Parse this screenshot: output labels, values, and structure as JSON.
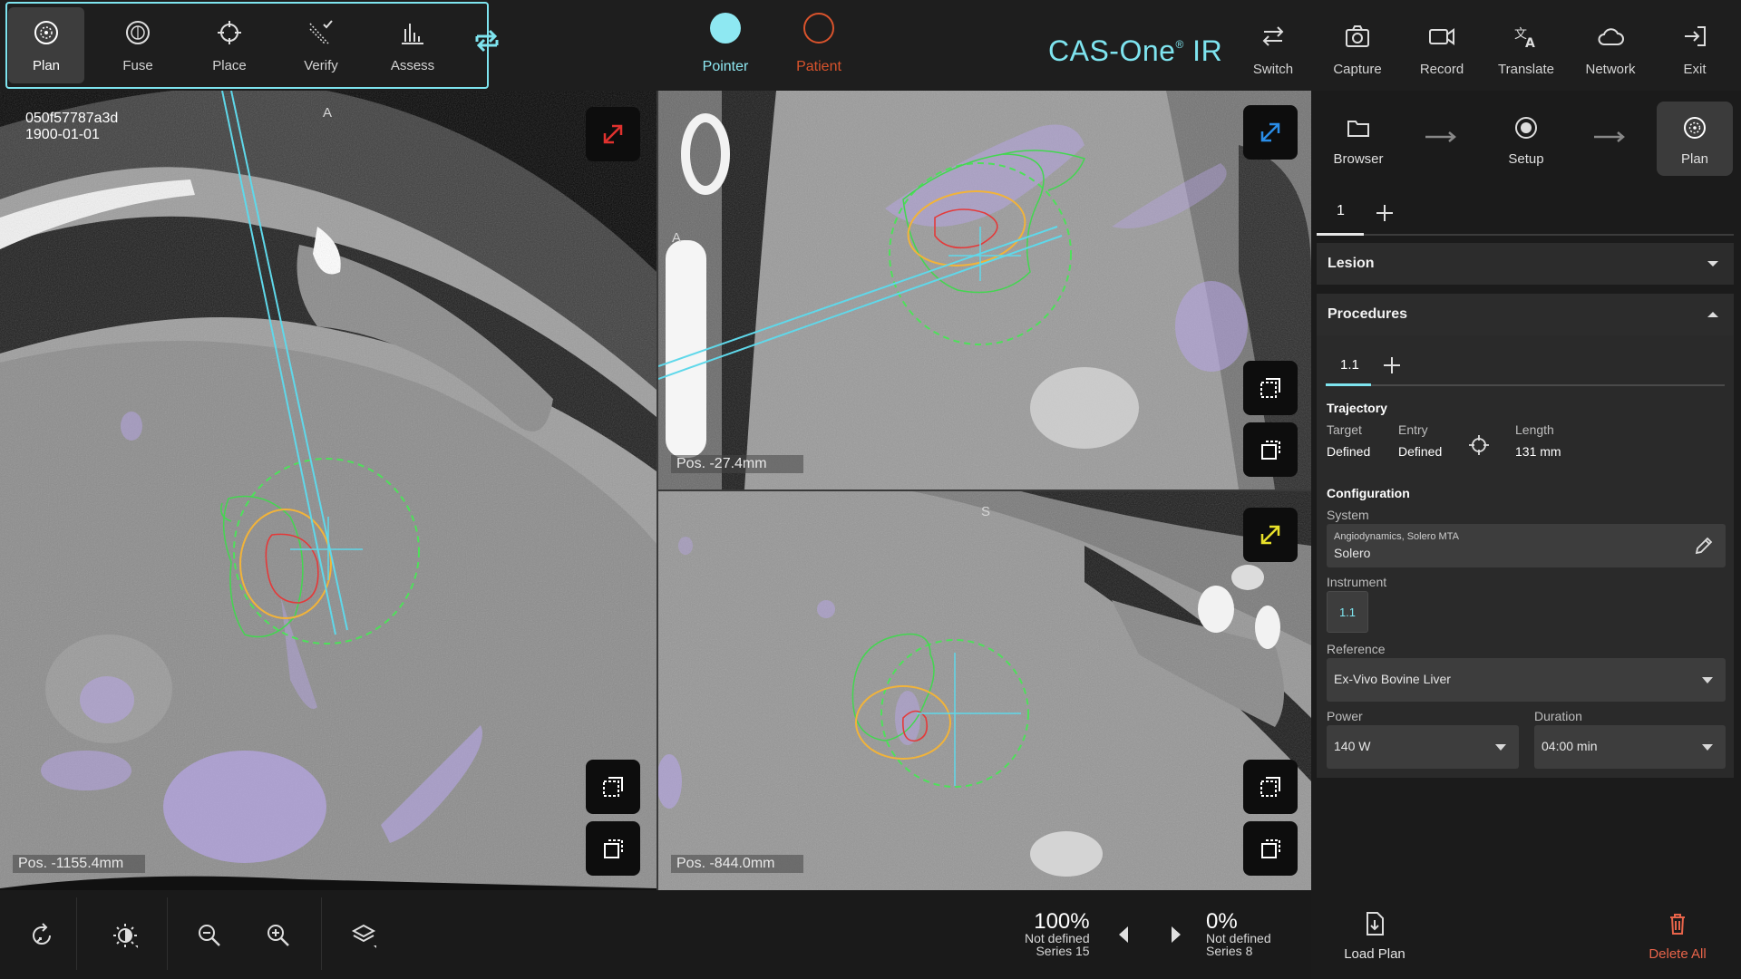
{
  "toolbar": {
    "workflow": [
      {
        "label": "Plan",
        "icon": "plan-icon",
        "active": true
      },
      {
        "label": "Fuse",
        "icon": "fuse-icon"
      },
      {
        "label": "Place",
        "icon": "place-icon"
      },
      {
        "label": "Verify",
        "icon": "verify-icon"
      },
      {
        "label": "Assess",
        "icon": "assess-icon"
      }
    ],
    "modes": [
      {
        "label": "Pointer",
        "color": "#8ee8f2"
      },
      {
        "label": "Patient",
        "color": "#d9532c"
      }
    ],
    "brand": "CAS-One",
    "brand_suffix": "IR",
    "brand_mark": "®",
    "actions": [
      {
        "label": "Switch",
        "icon": "switch-icon"
      },
      {
        "label": "Capture",
        "icon": "camera-icon"
      },
      {
        "label": "Record",
        "icon": "video-icon"
      },
      {
        "label": "Translate",
        "icon": "translate-icon"
      },
      {
        "label": "Network",
        "icon": "cloud-icon"
      },
      {
        "label": "Exit",
        "icon": "exit-icon"
      }
    ]
  },
  "viewports": {
    "axial": {
      "study_id": "050f57787a3d",
      "study_date": "1900-01-01",
      "orient_top": "A",
      "pos": "Pos. -1155.4mm"
    },
    "top_right": {
      "orient_left": "A",
      "pos": "Pos. -27.4mm"
    },
    "bottom_right": {
      "orient_top": "S",
      "pos": "Pos. -844.0mm"
    }
  },
  "bottom": {
    "left_series": {
      "percent": "100%",
      "status": "Not defined",
      "series": "Series 15"
    },
    "right_series": {
      "percent": "0%",
      "status": "Not defined",
      "series": "Series 8"
    }
  },
  "panel": {
    "steps": [
      {
        "label": "Browser",
        "icon": "folder-icon"
      },
      {
        "label": "Setup",
        "icon": "setup-icon"
      },
      {
        "label": "Plan",
        "icon": "plan-icon",
        "active": true
      }
    ],
    "lesion_tabs": [
      "1"
    ],
    "lesion_title": "Lesion",
    "procedures_title": "Procedures",
    "procedure_tabs": [
      "1.1"
    ],
    "trajectory": {
      "title": "Trajectory",
      "target_label": "Target",
      "target_value": "Defined",
      "entry_label": "Entry",
      "entry_value": "Defined",
      "length_label": "Length",
      "length_value": "131 mm"
    },
    "configuration": {
      "title": "Configuration",
      "system_label": "System",
      "system_line1": "Angiodynamics, Solero MTA",
      "system_line2": "Solero",
      "instrument_label": "Instrument",
      "instrument_value": "1.1",
      "reference_label": "Reference",
      "reference_value": "Ex-Vivo Bovine Liver",
      "power_label": "Power",
      "power_value": "140 W",
      "duration_label": "Duration",
      "duration_value": "04:00 min"
    },
    "load_plan": "Load Plan",
    "delete_all": "Delete All",
    "delete_color": "#e8644a"
  }
}
